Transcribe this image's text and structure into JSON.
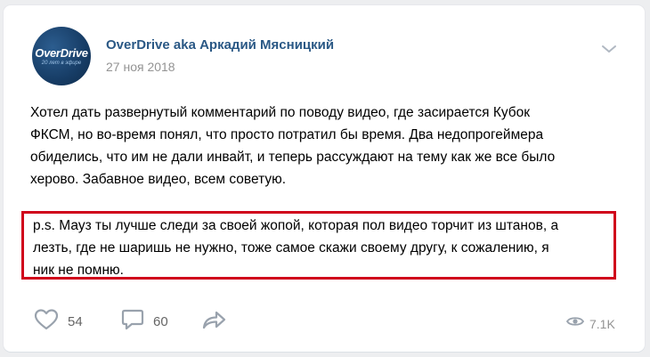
{
  "post": {
    "author": "OverDrive aka Аркадий Мясницкий",
    "date": "27 ноя 2018",
    "avatar_brand": "OverDrive",
    "avatar_tagline": "20 лет в эфире",
    "body_lines": [
      "Хотел дать развернутый комментарий по поводу видео, где засирается Кубок",
      "ФКСМ, но во-время понял, что просто потратил бы время. Два недопрогеймера",
      "обиделись, что им не дали инвайт, и теперь рассуждают на тему как же все было",
      "херово. Забавное видео, всем советую."
    ],
    "ps_lines": [
      "p.s. Мауз ты лучше следи за своей жопой, которая пол видео торчит из штанов, а",
      "лезть, где не шаришь не нужно, тоже самое скажи своему другу, к сожалению, я",
      "ник не помню."
    ]
  },
  "actions": {
    "likes": "54",
    "comments": "60",
    "views": "7.1K",
    "icons": [
      "heart-icon",
      "comment-icon",
      "share-icon",
      "eye-icon",
      "chevron-down-icon"
    ]
  },
  "colors": {
    "author": "#2a5885",
    "highlight_border": "#d0021b",
    "icon": "#99a2ad"
  }
}
